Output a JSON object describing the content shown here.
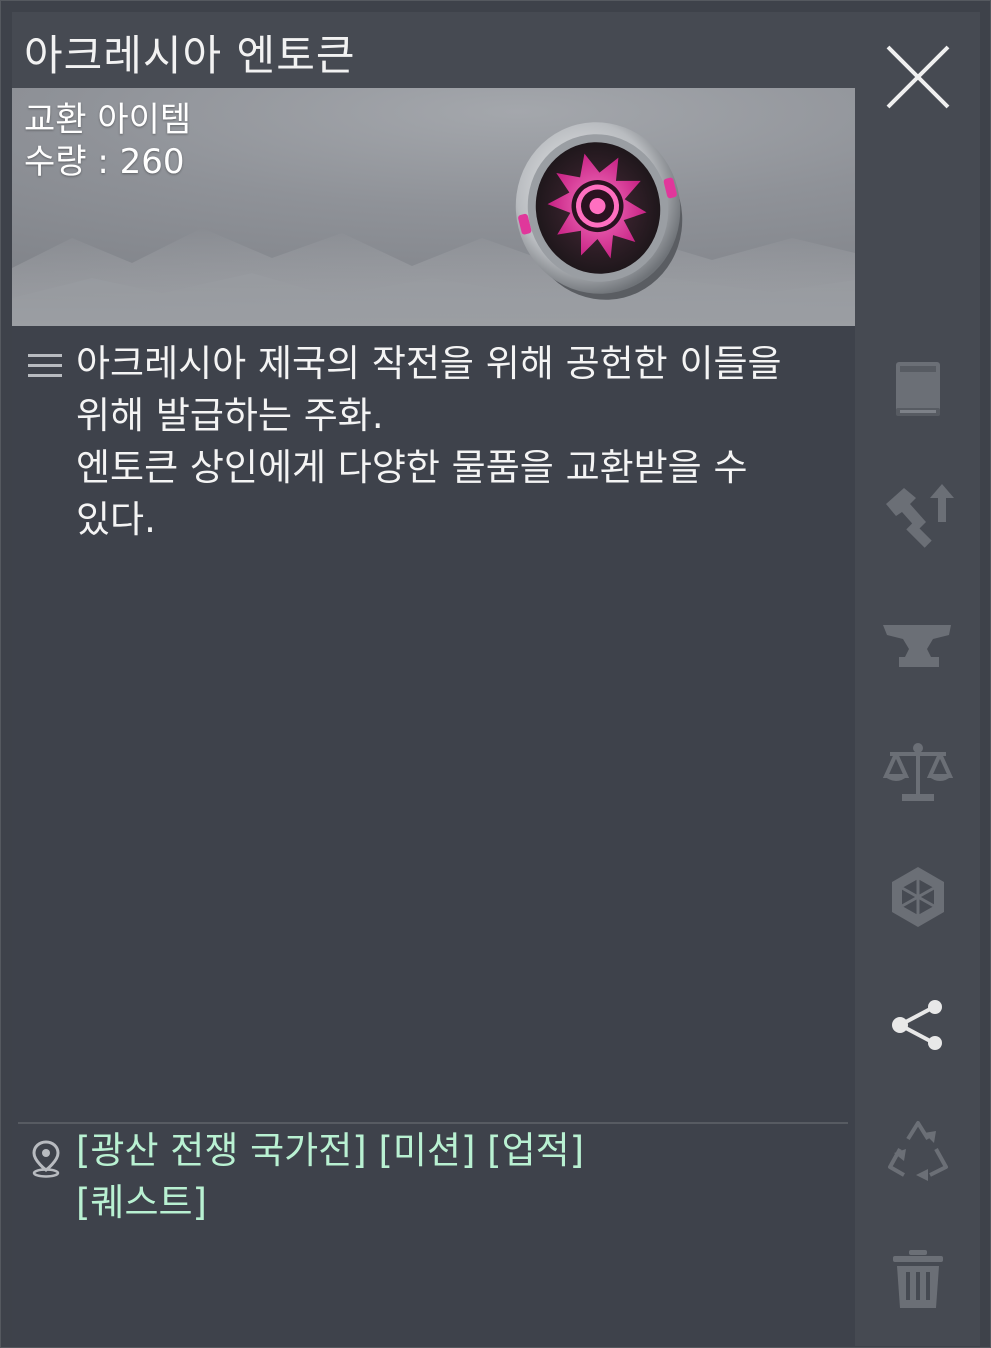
{
  "item": {
    "name": "아크레시아 엔토큰",
    "type": "교환 아이템",
    "quantity_text": "수량 : 260",
    "description_lines": [
      "아크레시아 제국의 작전을 위해 공헌한 이들을",
      "위해 발급하는 주화.",
      "엔토큰 상인에게 다양한 물품을 교환받을 수",
      "있다."
    ],
    "sources": [
      "[광산 전쟁 국가전]",
      "[미션]",
      "[업적]",
      "[퀘스트]"
    ]
  },
  "icons": {
    "close": "close-icon",
    "description": "list-icon",
    "location": "map-pin-icon",
    "sidebar": [
      "book-icon",
      "hammer-upgrade-icon",
      "anvil-icon",
      "scale-icon",
      "gem-socket-icon",
      "share-icon",
      "recycle-icon",
      "trash-icon"
    ]
  },
  "colors": {
    "panel": "#3e424b",
    "sidebar": "#464a52",
    "source_text": "#b9f1d2",
    "icon_active": "#e8e8e8",
    "icon_disabled": "#6b6f76",
    "coin_glow": "#e0379b"
  }
}
